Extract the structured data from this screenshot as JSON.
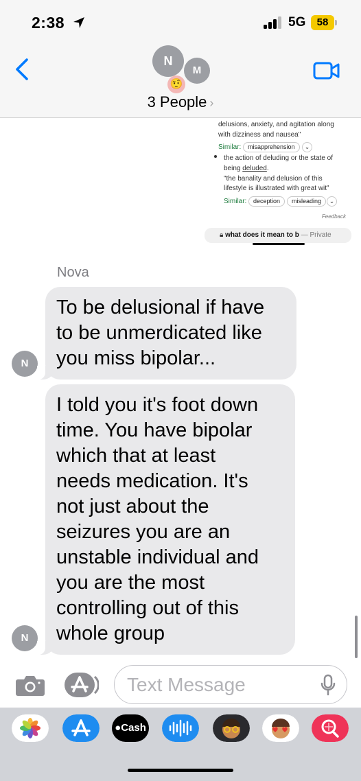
{
  "status_bar": {
    "time": "2:38",
    "network": "5G",
    "battery": "58"
  },
  "header": {
    "avatar_initial_1": "N",
    "avatar_initial_2": "M",
    "avatar_emoji": "🤨",
    "title": "3 People",
    "chevron": "›"
  },
  "shared_screenshot": {
    "line_1": "delusions, anxiety, and agitation along",
    "line_2": "with dizziness and nausea\"",
    "similar_label": "Similar:",
    "similar_chip_1": "misapprehension",
    "def_line_1": "the action of deluding or the state of",
    "def_line_2_prefix": "being ",
    "def_line_2_link": "deluded",
    "def_line_2_suffix": ".",
    "example_line_1": "\"the banality and delusion of this",
    "example_line_2": "lifestyle is illustrated with great wit\"",
    "similar_chip_2": "deception",
    "similar_chip_3": "misleading",
    "feedback": "Feedback",
    "url_query": "what does it mean to b",
    "url_private": "— Private"
  },
  "conversation": {
    "sender_name": "Nova",
    "messages": [
      {
        "avatar": "N",
        "lines": [
          "To be delusional if have",
          "to be unmerdicated like",
          "you miss bipolar..."
        ]
      },
      {
        "avatar": "N",
        "lines": [
          "I told you it's foot down",
          "time. You have bipolar",
          "which that at least",
          "needs medication. It's",
          "not just about the",
          "seizures you are an",
          "unstable individual and",
          "you are the most",
          "controlling out of this",
          "whole group"
        ]
      }
    ]
  },
  "composer": {
    "placeholder": "Text Message"
  },
  "app_drawer": {
    "apps": [
      "photos-icon",
      "app-store-icon",
      "apple-cash-icon",
      "audio-message-icon",
      "memoji-icon",
      "memoji-sticker-icon",
      "search-images-icon"
    ],
    "cash_label": "Cash"
  },
  "colors": {
    "accent": "#007aff",
    "bubble": "#e9e9eb",
    "battery": "#f5c900"
  }
}
